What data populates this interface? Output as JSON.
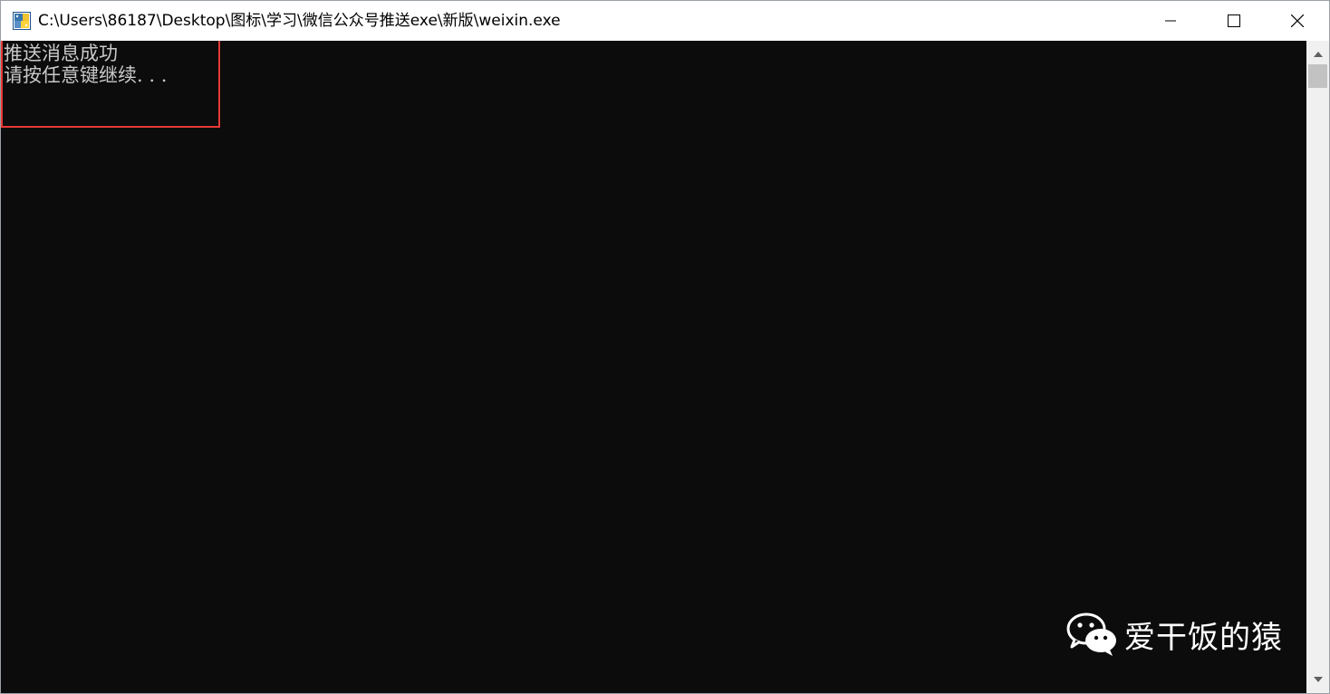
{
  "window": {
    "title": "C:\\Users\\86187\\Desktop\\图标\\学习\\微信公众号推送exe\\新版\\weixin.exe"
  },
  "console": {
    "lines": [
      "推送消息成功",
      "请按任意键继续. . ."
    ]
  },
  "watermark": {
    "text": "爱干饭的猿"
  },
  "colors": {
    "console_bg": "#0c0c0c",
    "console_text": "#c8c8c8",
    "highlight": "#e53935"
  }
}
